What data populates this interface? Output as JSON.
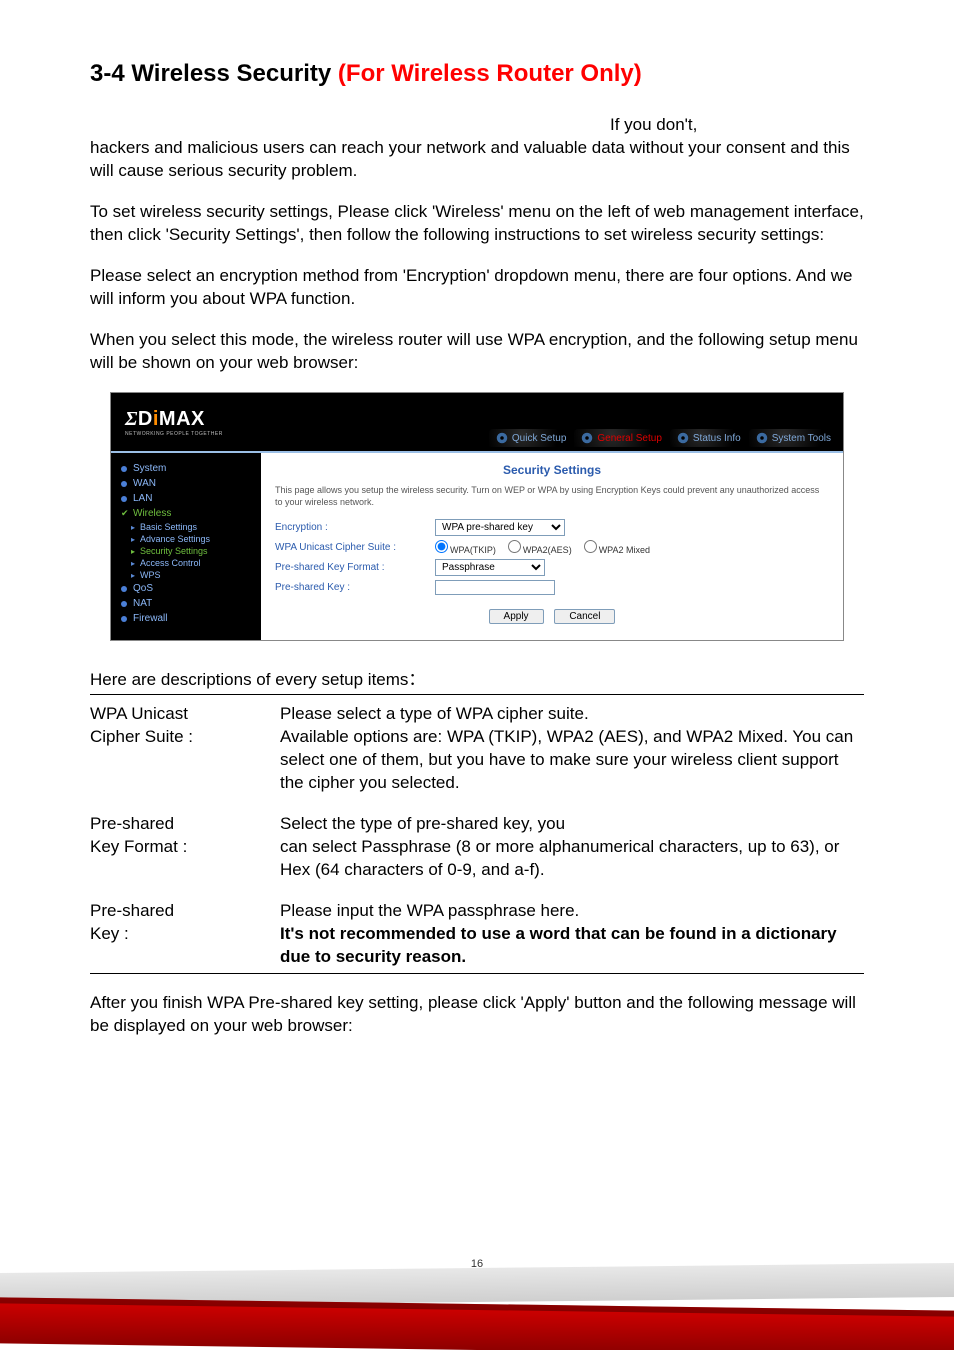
{
  "title": {
    "prefix": "3-4 Wireless Security ",
    "suffix": "(For Wireless Router Only)"
  },
  "paragraphs": {
    "p1a": "If you don't,",
    "p1b": "hackers and malicious users can reach your network and valuable data without your consent and this will cause serious security problem.",
    "p2": "To set wireless security settings, Please click 'Wireless' menu on the left of web management interface, then click 'Security Settings', then follow the following instructions to set wireless security settings:",
    "p3": "Please select an encryption method from 'Encryption' dropdown menu, there are four options. And we will inform you about WPA function.",
    "p4": "When you select this mode, the wireless router will use WPA encryption, and the following setup menu will be shown on your web browser:"
  },
  "shot": {
    "logo": {
      "networking": "NETWORKING PEOPLE TOGETHER"
    },
    "tabs": {
      "quick": "Quick Setup",
      "general": "General Setup",
      "status": "Status Info",
      "tools": "System Tools"
    },
    "sidebar": {
      "system": "System",
      "wan": "WAN",
      "lan": "LAN",
      "wireless": "Wireless",
      "basic": "Basic Settings",
      "advance": "Advance Settings",
      "security": "Security Settings",
      "access": "Access Control",
      "wps": "WPS",
      "qos": "QoS",
      "nat": "NAT",
      "firewall": "Firewall"
    },
    "content": {
      "title": "Security Settings",
      "desc": "This page allows you setup the wireless security. Turn on WEP or WPA by using Encryption Keys could prevent any unauthorized access to your wireless network.",
      "labels": {
        "encryption": "Encryption :",
        "cipher": "WPA Unicast Cipher Suite :",
        "format": "Pre-shared Key Format :",
        "key": "Pre-shared Key :"
      },
      "values": {
        "encryption": "WPA pre-shared key",
        "format": "Passphrase"
      },
      "radios": {
        "r1": "WPA(TKIP)",
        "r2": "WPA2(AES)",
        "r3": "WPA2 Mixed"
      },
      "buttons": {
        "apply": "Apply",
        "cancel": "Cancel"
      }
    }
  },
  "defs": {
    "intro": "Here are descriptions of every setup items：",
    "rows": [
      {
        "term1": "WPA Unicast",
        "term2": "Cipher Suite :",
        "desc": "Please select a type of WPA cipher suite.\nAvailable options are: WPA (TKIP), WPA2 (AES), and WPA2 Mixed. You can select one of them, but you have to make sure your wireless client support the cipher you selected."
      },
      {
        "term1": "Pre-shared",
        "term2": "Key Format :",
        "desc": "Select the type of pre-shared key, you\n can select Passphrase (8 or more alphanumerical characters, up to 63), or Hex (64 characters of 0-9, and a-f)."
      },
      {
        "term1": "Pre-shared",
        "term2": "Key :",
        "desc_plain": "Please input the WPA passphrase here.",
        "desc_bold": "It's not recommended to use a word that can be found in a dictionary due to security reason."
      }
    ]
  },
  "after": "After you finish WPA Pre-shared key setting, please click 'Apply' button and the following message will be displayed on your web browser:",
  "page_number": "16"
}
